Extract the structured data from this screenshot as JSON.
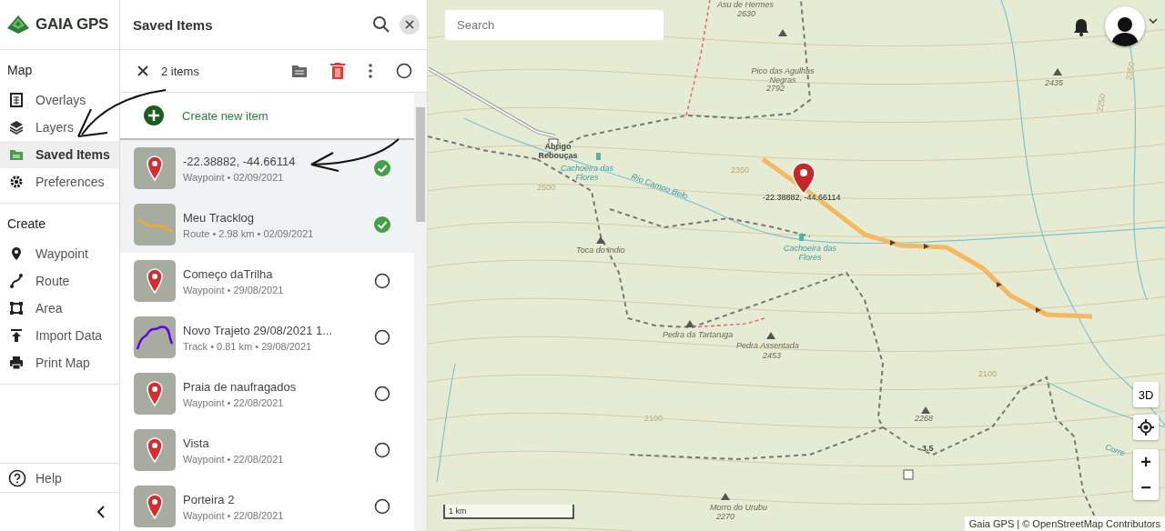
{
  "brand": "GAIA GPS",
  "nav": {
    "sections": [
      {
        "title": "Map",
        "items": [
          {
            "label": "Overlays",
            "selected": false
          },
          {
            "label": "Layers",
            "selected": false
          },
          {
            "label": "Saved Items",
            "selected": true
          },
          {
            "label": "Preferences",
            "selected": false
          }
        ]
      },
      {
        "title": "Create",
        "items": [
          {
            "label": "Waypoint",
            "selected": false
          },
          {
            "label": "Route",
            "selected": false
          },
          {
            "label": "Area",
            "selected": false
          },
          {
            "label": "Import Data",
            "selected": false
          },
          {
            "label": "Print Map",
            "selected": false
          }
        ]
      }
    ],
    "help": "Help"
  },
  "panel": {
    "title": "Saved Items",
    "selection_count": "2 items",
    "all_checked": false,
    "create_label": "Create new item",
    "items": [
      {
        "title": "-22.38882, -44.66114",
        "subtitle": "Waypoint • 02/09/2021",
        "kind": "waypoint",
        "checked": true
      },
      {
        "title": "Meu Tracklog",
        "subtitle": "Route • 2.98 km • 02/09/2021",
        "kind": "route",
        "checked": true
      },
      {
        "title": "Começo daTrilha",
        "subtitle": "Waypoint • 29/08/2021",
        "kind": "waypoint",
        "checked": false
      },
      {
        "title": "Novo Trajeto 29/08/2021 1...",
        "subtitle": "Track • 0.81 km • 29/08/2021",
        "kind": "track",
        "checked": false
      },
      {
        "title": "Praia de naufragados",
        "subtitle": "Waypoint • 22/08/2021",
        "kind": "waypoint",
        "checked": false
      },
      {
        "title": "Vista",
        "subtitle": "Waypoint • 22/08/2021",
        "kind": "waypoint",
        "checked": false
      },
      {
        "title": "Porteira 2",
        "subtitle": "Waypoint • 22/08/2021",
        "kind": "waypoint",
        "checked": false
      }
    ]
  },
  "map": {
    "search": {
      "placeholder": "Search"
    },
    "labels": [
      {
        "text": "Asu de Hermes",
        "kind": "peak"
      },
      {
        "text": "2630",
        "kind": "elevation"
      },
      {
        "text": "Pico das Agulhas Negras",
        "kind": "peak"
      },
      {
        "text": "2792",
        "kind": "elevation"
      },
      {
        "text": "2435",
        "kind": "elevation"
      },
      {
        "text": "Abrigo Rebouças",
        "kind": "place"
      },
      {
        "text": "Cachoeira das Flores",
        "kind": "water"
      },
      {
        "text": "Rio Campo Belo",
        "kind": "water"
      },
      {
        "text": "2500",
        "kind": "contour"
      },
      {
        "text": "2350",
        "kind": "contour"
      },
      {
        "text": "-22.38882, -44.66114",
        "kind": "coord"
      },
      {
        "text": "Toca do Indio",
        "kind": "peak"
      },
      {
        "text": "Cachoeira das Flores",
        "kind": "water"
      },
      {
        "text": "Pedra da Tartaruga",
        "kind": "peak"
      },
      {
        "text": "Pedra Assentada",
        "kind": "peak"
      },
      {
        "text": "2453",
        "kind": "elevation"
      },
      {
        "text": "2100",
        "kind": "contour"
      },
      {
        "text": "2100",
        "kind": "contour"
      },
      {
        "text": "2268",
        "kind": "elevation"
      },
      {
        "text": "3.5",
        "kind": "place"
      },
      {
        "text": "Morro do Urubu",
        "kind": "peak"
      },
      {
        "text": "2270",
        "kind": "elevation"
      },
      {
        "text": "2350",
        "kind": "contour"
      },
      {
        "text": "2250",
        "kind": "contour"
      },
      {
        "text": "Corre",
        "kind": "water"
      }
    ],
    "controls": {
      "three_d": "3D",
      "zoom_in": "+",
      "zoom_out": "−"
    },
    "scale": "1 km",
    "attribution": "Gaia GPS | © OpenStreetMap Contributors"
  }
}
